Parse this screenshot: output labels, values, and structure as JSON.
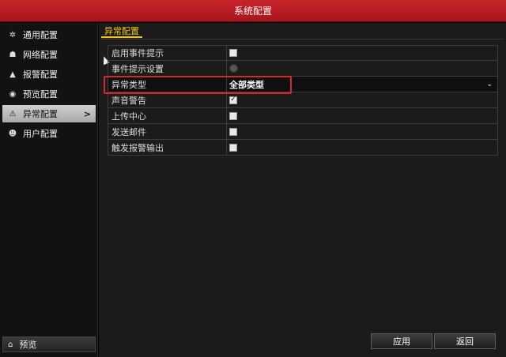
{
  "window": {
    "title": "系统配置"
  },
  "sidebar": {
    "items": [
      {
        "label": "通用配置",
        "icon": "gear-icon",
        "glyph": "✲",
        "active": false
      },
      {
        "label": "网络配置",
        "icon": "network-icon",
        "glyph": "☗",
        "active": false
      },
      {
        "label": "报警配置",
        "icon": "alarm-icon",
        "glyph": "▲",
        "active": false
      },
      {
        "label": "预览配置",
        "icon": "eye-icon",
        "glyph": "◉",
        "active": false
      },
      {
        "label": "异常配置",
        "icon": "warning-icon",
        "glyph": "⚠",
        "active": true
      },
      {
        "label": "用户配置",
        "icon": "users-icon",
        "glyph": "☻",
        "active": false
      }
    ],
    "preview_button": {
      "label": "预览",
      "icon": "home-icon"
    }
  },
  "main": {
    "section_title": "异常配置",
    "rows": [
      {
        "label": "启用事件提示",
        "control": "checkbox",
        "checked": false
      },
      {
        "label": "事件提示设置",
        "control": "settings-button"
      },
      {
        "label": "异常类型",
        "control": "select",
        "value": "全部类型"
      },
      {
        "label": "声音警告",
        "control": "checkbox",
        "checked": true
      },
      {
        "label": "上传中心",
        "control": "checkbox",
        "checked": false
      },
      {
        "label": "发送邮件",
        "control": "checkbox",
        "checked": false
      },
      {
        "label": "触发报警输出",
        "control": "checkbox",
        "checked": false
      }
    ],
    "buttons": {
      "apply": "应用",
      "back": "返回"
    }
  },
  "colors": {
    "titlebar": "#b81c22",
    "section_accent": "#f0c800",
    "highlight": "#d9262c"
  }
}
